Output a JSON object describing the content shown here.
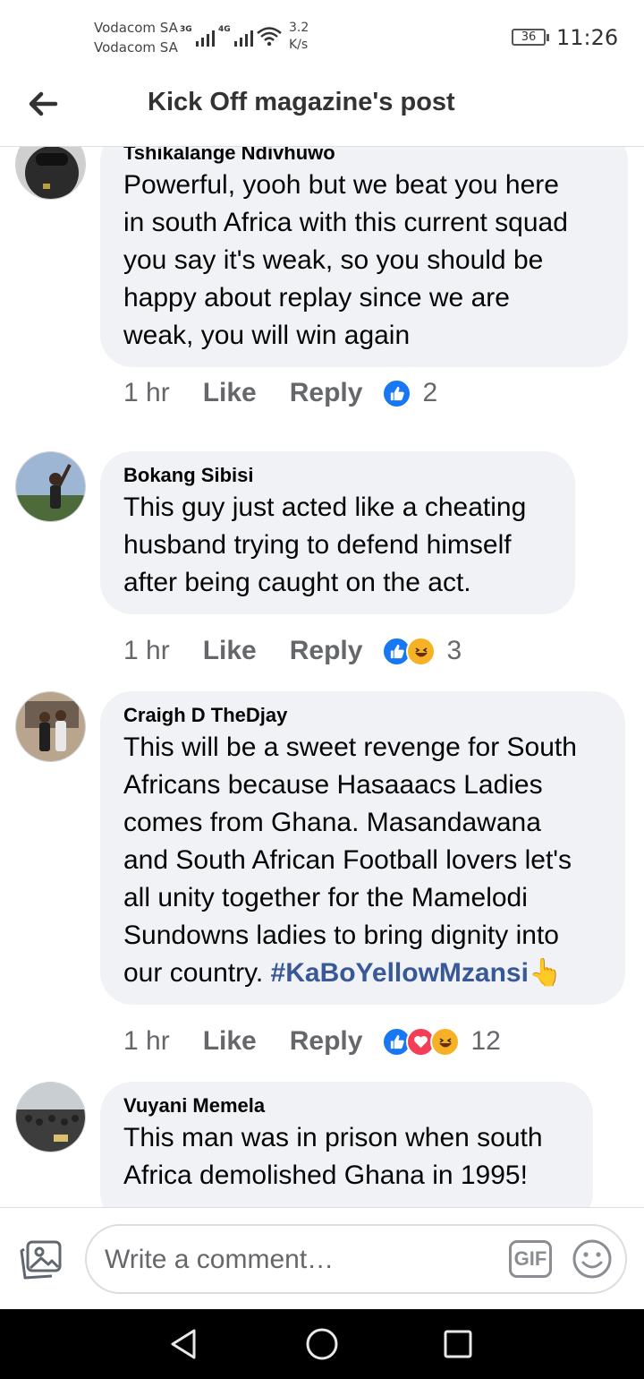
{
  "status_bar": {
    "carrier_1": "Vodacom SA",
    "carrier_2": "Vodacom SA",
    "net_1": "3G",
    "net_2": "4G",
    "speed_value": "3.2",
    "speed_unit": "K/s",
    "battery": "36",
    "time": "11:26"
  },
  "header": {
    "title": "Kick Off magazine's post",
    "back_icon": "arrow-left-icon"
  },
  "comments": [
    {
      "author": "Tshikalange Ndivhuwo",
      "lines": [
        "Powerful, yooh but we beat you here",
        "in south Africa with this current squad",
        "you say it's weak, so you should be",
        "happy about replay since we are",
        "weak, you will win again"
      ],
      "time": "1 hr",
      "like_label": "Like",
      "reply_label": "Reply",
      "reactions": [
        "like"
      ],
      "reaction_count": "2"
    },
    {
      "author": "Bokang Sibisi",
      "lines": [
        "This guy just acted like a cheating",
        "husband trying to defend himself",
        "after being caught on the act."
      ],
      "time": "1 hr",
      "like_label": "Like",
      "reply_label": "Reply",
      "reactions": [
        "like",
        "haha"
      ],
      "reaction_count": "3"
    },
    {
      "author": "Craigh D TheDjay",
      "lines": [
        "This will be a sweet revenge for South",
        "Africans because Hasaaacs Ladies",
        "comes from Ghana. Masandawana",
        "and South African Football lovers let's",
        "all unity together for the Mamelodi",
        "Sundowns ladies to bring dignity into"
      ],
      "last_line_text": "our country.",
      "hashtag": "#KaBoYellowMzansi",
      "trailing_emoji": "👆",
      "time": "1 hr",
      "like_label": "Like",
      "reply_label": "Reply",
      "reactions": [
        "like",
        "love",
        "haha"
      ],
      "reaction_count": "12"
    },
    {
      "author": "Vuyani Memela",
      "lines": [
        "This man was in prison when south",
        "Africa demolished Ghana in 1995!"
      ]
    }
  ],
  "composer": {
    "placeholder": "Write a comment…",
    "gif_label": "GIF",
    "photo_icon": "photo-icon",
    "emoji_icon": "smiley-icon"
  },
  "nav": {
    "back_icon": "triangle-back-icon",
    "home_icon": "circle-home-icon",
    "recents_icon": "square-recents-icon"
  },
  "colors": {
    "bubble": "#f0f2f5",
    "hashtag": "#385898",
    "like_blue": "#1877f2",
    "love_red": "#f33e58",
    "haha_yellow": "#f7b125",
    "meta_gray": "#65676b"
  }
}
